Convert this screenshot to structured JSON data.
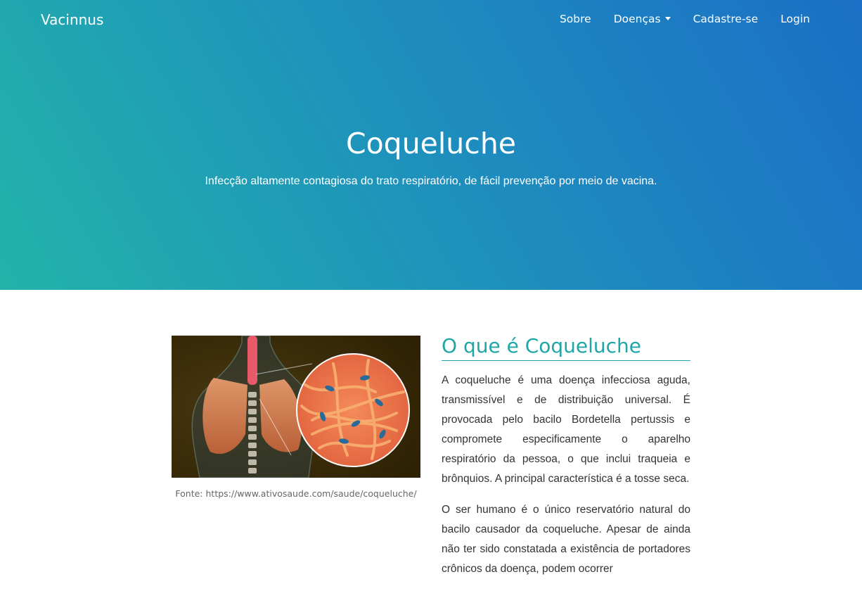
{
  "nav": {
    "brand": "Vacinnus",
    "items": [
      {
        "label": "Sobre"
      },
      {
        "label": "Doenças"
      },
      {
        "label": "Cadastre-se"
      },
      {
        "label": "Login"
      }
    ]
  },
  "hero": {
    "title": "Coqueluche",
    "subtitle": "Infecção altamente contagiosa do trato respiratório, de fácil prevenção por meio de vacina."
  },
  "figure": {
    "caption": "Fonte: https://www.ativosaude.com/saude/coqueluche/"
  },
  "article": {
    "heading": "O que é Coqueluche",
    "paragraphs": [
      "A coqueluche é uma doença infecciosa aguda, transmissível e de distribuição universal. É provocada pelo bacilo Bordetella pertussis e compromete especificamente o aparelho respiratório da pessoa, o que inclui traqueia e brônquios. A principal característica é a tosse seca.",
      "O ser humano é o único reservatório natural do bacilo causador da coqueluche. Apesar de ainda não ter sido constatada a existência de portadores crônicos da doença, podem ocorrer"
    ]
  },
  "colors": {
    "accent": "#1fa6a6",
    "hero_start": "#22b4a9",
    "hero_end": "#1b6fc6"
  }
}
